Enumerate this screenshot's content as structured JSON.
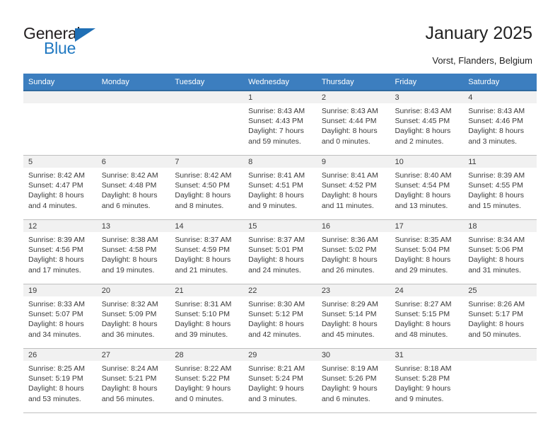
{
  "brand": {
    "name_part1": "General",
    "name_part2": "Blue",
    "triangle_color": "#1f6fb5",
    "blue_color": "#1f78c1"
  },
  "header": {
    "title": "January 2025",
    "location": "Vorst, Flanders, Belgium"
  },
  "theme": {
    "header_row_bg": "#3c7ebf",
    "header_row_border": "#2f6a9f",
    "daynum_band_bg": "#f1f1f1",
    "cell_border": "#bfbfbf"
  },
  "weekday_headers": [
    "Sunday",
    "Monday",
    "Tuesday",
    "Wednesday",
    "Thursday",
    "Friday",
    "Saturday"
  ],
  "labels": {
    "sunrise_prefix": "Sunrise:",
    "sunset_prefix": "Sunset:",
    "daylight_prefix": "Daylight:"
  },
  "weeks": [
    [
      {
        "day": "",
        "line1": "",
        "line2": "",
        "line3": "",
        "line4": "",
        "empty": true
      },
      {
        "day": "",
        "line1": "",
        "line2": "",
        "line3": "",
        "line4": "",
        "empty": true
      },
      {
        "day": "",
        "line1": "",
        "line2": "",
        "line3": "",
        "line4": "",
        "empty": true
      },
      {
        "day": "1",
        "line1": "Sunrise: 8:43 AM",
        "line2": "Sunset: 4:43 PM",
        "line3": "Daylight: 7 hours",
        "line4": "and 59 minutes.",
        "empty": false
      },
      {
        "day": "2",
        "line1": "Sunrise: 8:43 AM",
        "line2": "Sunset: 4:44 PM",
        "line3": "Daylight: 8 hours",
        "line4": "and 0 minutes.",
        "empty": false
      },
      {
        "day": "3",
        "line1": "Sunrise: 8:43 AM",
        "line2": "Sunset: 4:45 PM",
        "line3": "Daylight: 8 hours",
        "line4": "and 2 minutes.",
        "empty": false
      },
      {
        "day": "4",
        "line1": "Sunrise: 8:43 AM",
        "line2": "Sunset: 4:46 PM",
        "line3": "Daylight: 8 hours",
        "line4": "and 3 minutes.",
        "empty": false
      }
    ],
    [
      {
        "day": "5",
        "line1": "Sunrise: 8:42 AM",
        "line2": "Sunset: 4:47 PM",
        "line3": "Daylight: 8 hours",
        "line4": "and 4 minutes.",
        "empty": false
      },
      {
        "day": "6",
        "line1": "Sunrise: 8:42 AM",
        "line2": "Sunset: 4:48 PM",
        "line3": "Daylight: 8 hours",
        "line4": "and 6 minutes.",
        "empty": false
      },
      {
        "day": "7",
        "line1": "Sunrise: 8:42 AM",
        "line2": "Sunset: 4:50 PM",
        "line3": "Daylight: 8 hours",
        "line4": "and 8 minutes.",
        "empty": false
      },
      {
        "day": "8",
        "line1": "Sunrise: 8:41 AM",
        "line2": "Sunset: 4:51 PM",
        "line3": "Daylight: 8 hours",
        "line4": "and 9 minutes.",
        "empty": false
      },
      {
        "day": "9",
        "line1": "Sunrise: 8:41 AM",
        "line2": "Sunset: 4:52 PM",
        "line3": "Daylight: 8 hours",
        "line4": "and 11 minutes.",
        "empty": false
      },
      {
        "day": "10",
        "line1": "Sunrise: 8:40 AM",
        "line2": "Sunset: 4:54 PM",
        "line3": "Daylight: 8 hours",
        "line4": "and 13 minutes.",
        "empty": false
      },
      {
        "day": "11",
        "line1": "Sunrise: 8:39 AM",
        "line2": "Sunset: 4:55 PM",
        "line3": "Daylight: 8 hours",
        "line4": "and 15 minutes.",
        "empty": false
      }
    ],
    [
      {
        "day": "12",
        "line1": "Sunrise: 8:39 AM",
        "line2": "Sunset: 4:56 PM",
        "line3": "Daylight: 8 hours",
        "line4": "and 17 minutes.",
        "empty": false
      },
      {
        "day": "13",
        "line1": "Sunrise: 8:38 AM",
        "line2": "Sunset: 4:58 PM",
        "line3": "Daylight: 8 hours",
        "line4": "and 19 minutes.",
        "empty": false
      },
      {
        "day": "14",
        "line1": "Sunrise: 8:37 AM",
        "line2": "Sunset: 4:59 PM",
        "line3": "Daylight: 8 hours",
        "line4": "and 21 minutes.",
        "empty": false
      },
      {
        "day": "15",
        "line1": "Sunrise: 8:37 AM",
        "line2": "Sunset: 5:01 PM",
        "line3": "Daylight: 8 hours",
        "line4": "and 24 minutes.",
        "empty": false
      },
      {
        "day": "16",
        "line1": "Sunrise: 8:36 AM",
        "line2": "Sunset: 5:02 PM",
        "line3": "Daylight: 8 hours",
        "line4": "and 26 minutes.",
        "empty": false
      },
      {
        "day": "17",
        "line1": "Sunrise: 8:35 AM",
        "line2": "Sunset: 5:04 PM",
        "line3": "Daylight: 8 hours",
        "line4": "and 29 minutes.",
        "empty": false
      },
      {
        "day": "18",
        "line1": "Sunrise: 8:34 AM",
        "line2": "Sunset: 5:06 PM",
        "line3": "Daylight: 8 hours",
        "line4": "and 31 minutes.",
        "empty": false
      }
    ],
    [
      {
        "day": "19",
        "line1": "Sunrise: 8:33 AM",
        "line2": "Sunset: 5:07 PM",
        "line3": "Daylight: 8 hours",
        "line4": "and 34 minutes.",
        "empty": false
      },
      {
        "day": "20",
        "line1": "Sunrise: 8:32 AM",
        "line2": "Sunset: 5:09 PM",
        "line3": "Daylight: 8 hours",
        "line4": "and 36 minutes.",
        "empty": false
      },
      {
        "day": "21",
        "line1": "Sunrise: 8:31 AM",
        "line2": "Sunset: 5:10 PM",
        "line3": "Daylight: 8 hours",
        "line4": "and 39 minutes.",
        "empty": false
      },
      {
        "day": "22",
        "line1": "Sunrise: 8:30 AM",
        "line2": "Sunset: 5:12 PM",
        "line3": "Daylight: 8 hours",
        "line4": "and 42 minutes.",
        "empty": false
      },
      {
        "day": "23",
        "line1": "Sunrise: 8:29 AM",
        "line2": "Sunset: 5:14 PM",
        "line3": "Daylight: 8 hours",
        "line4": "and 45 minutes.",
        "empty": false
      },
      {
        "day": "24",
        "line1": "Sunrise: 8:27 AM",
        "line2": "Sunset: 5:15 PM",
        "line3": "Daylight: 8 hours",
        "line4": "and 48 minutes.",
        "empty": false
      },
      {
        "day": "25",
        "line1": "Sunrise: 8:26 AM",
        "line2": "Sunset: 5:17 PM",
        "line3": "Daylight: 8 hours",
        "line4": "and 50 minutes.",
        "empty": false
      }
    ],
    [
      {
        "day": "26",
        "line1": "Sunrise: 8:25 AM",
        "line2": "Sunset: 5:19 PM",
        "line3": "Daylight: 8 hours",
        "line4": "and 53 minutes.",
        "empty": false
      },
      {
        "day": "27",
        "line1": "Sunrise: 8:24 AM",
        "line2": "Sunset: 5:21 PM",
        "line3": "Daylight: 8 hours",
        "line4": "and 56 minutes.",
        "empty": false
      },
      {
        "day": "28",
        "line1": "Sunrise: 8:22 AM",
        "line2": "Sunset: 5:22 PM",
        "line3": "Daylight: 9 hours",
        "line4": "and 0 minutes.",
        "empty": false
      },
      {
        "day": "29",
        "line1": "Sunrise: 8:21 AM",
        "line2": "Sunset: 5:24 PM",
        "line3": "Daylight: 9 hours",
        "line4": "and 3 minutes.",
        "empty": false
      },
      {
        "day": "30",
        "line1": "Sunrise: 8:19 AM",
        "line2": "Sunset: 5:26 PM",
        "line3": "Daylight: 9 hours",
        "line4": "and 6 minutes.",
        "empty": false
      },
      {
        "day": "31",
        "line1": "Sunrise: 8:18 AM",
        "line2": "Sunset: 5:28 PM",
        "line3": "Daylight: 9 hours",
        "line4": "and 9 minutes.",
        "empty": false
      },
      {
        "day": "",
        "line1": "",
        "line2": "",
        "line3": "",
        "line4": "",
        "empty": true
      }
    ]
  ]
}
